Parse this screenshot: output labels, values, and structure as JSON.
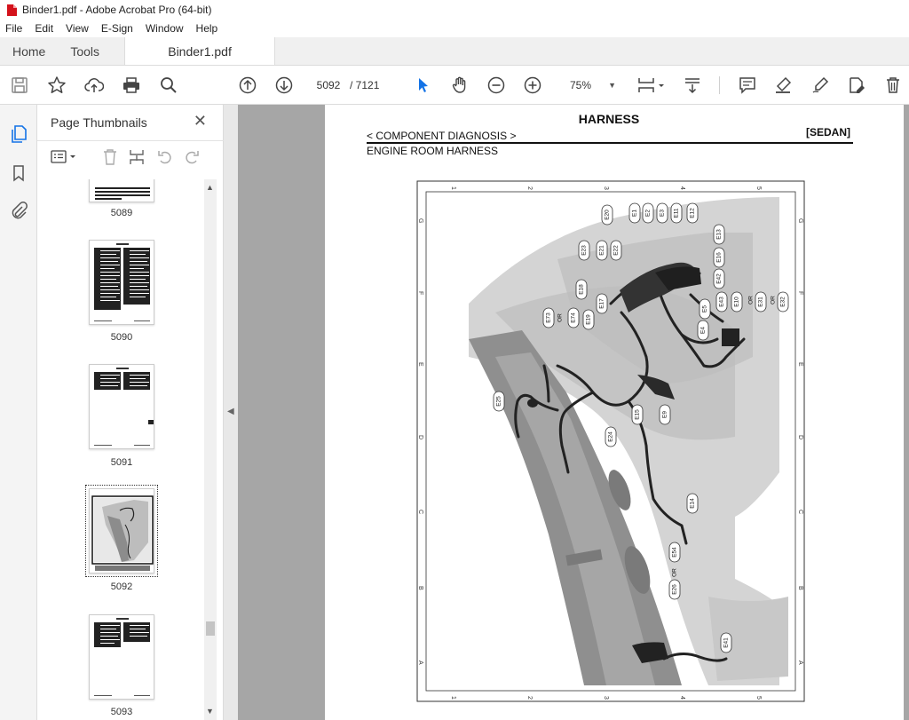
{
  "window": {
    "title": "Binder1.pdf - Adobe Acrobat Pro (64-bit)"
  },
  "menu": [
    "File",
    "Edit",
    "View",
    "E-Sign",
    "Window",
    "Help"
  ],
  "tabs": {
    "home": "Home",
    "tools": "Tools",
    "document": "Binder1.pdf"
  },
  "toolbar": {
    "page_current": "5092",
    "page_total": "/ 7121",
    "zoom": "75%"
  },
  "sidebar": {
    "title": "Page Thumbnails",
    "thumbnails": [
      {
        "label": "5089"
      },
      {
        "label": "5090"
      },
      {
        "label": "5091"
      },
      {
        "label": "5092",
        "selected": true
      },
      {
        "label": "5093"
      }
    ]
  },
  "page": {
    "header": "HARNESS",
    "breadcrumb": "< COMPONENT DIAGNOSIS >",
    "model": "[SEDAN]",
    "subtitle": "ENGINE ROOM HARNESS",
    "grid_cols": [
      "1",
      "2",
      "3",
      "4",
      "5"
    ],
    "grid_rows": [
      "G",
      "F",
      "E",
      "D",
      "C",
      "B",
      "A"
    ],
    "connectors": [
      "E20",
      "E1",
      "E2",
      "E3",
      "E11",
      "E12",
      "E13",
      "E16",
      "E42",
      "E43",
      "E5",
      "E4",
      "E10",
      "OR",
      "E31",
      "OR",
      "E32",
      "E23",
      "E21",
      "E22",
      "E18",
      "E17",
      "E73",
      "OR",
      "E74",
      "E19",
      "E25",
      "E15",
      "E9",
      "E24",
      "E14",
      "E54",
      "OR",
      "E26",
      "E41"
    ]
  },
  "colors": {
    "accent": "#1473e6",
    "viewer_bg": "#a6a6a6",
    "pdf_red": "#d4121b"
  }
}
